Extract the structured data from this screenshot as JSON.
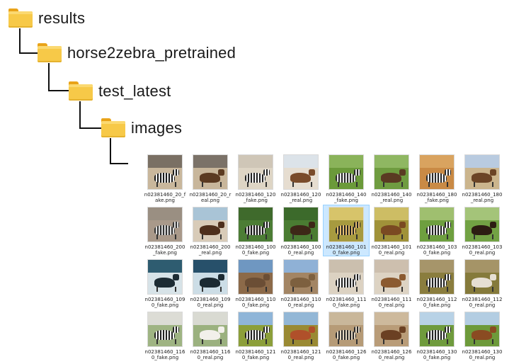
{
  "tree": {
    "results": "results",
    "horse2zebra": "horse2zebra_pretrained",
    "test_latest": "test_latest",
    "images": "images"
  },
  "files": [
    {
      "name": "n02381460_20_fake.png",
      "style": "bg-zebra-sand",
      "selected": false
    },
    {
      "name": "n02381460_20_real.png",
      "style": "bg-horse-sand",
      "selected": false
    },
    {
      "name": "n02381460_120_fake.png",
      "style": "bg-zebra-light",
      "selected": false
    },
    {
      "name": "n02381460_120_real.png",
      "style": "bg-horse-light",
      "selected": false
    },
    {
      "name": "n02381460_140_fake.png",
      "style": "bg-zebra-grass",
      "selected": false
    },
    {
      "name": "n02381460_140_real.png",
      "style": "bg-horse-grass",
      "selected": false
    },
    {
      "name": "n02381460_180_fake.png",
      "style": "bg-zebra-desert",
      "selected": false
    },
    {
      "name": "n02381460_180_real.png",
      "style": "bg-horse-desert",
      "selected": false
    },
    {
      "name": "n02381460_200_fake.png",
      "style": "bg-zebra-beach",
      "selected": false
    },
    {
      "name": "n02381460_200_real.png",
      "style": "bg-horse-beach",
      "selected": false
    },
    {
      "name": "n02381460_1000_fake.png",
      "style": "bg-zebra-forest",
      "selected": false
    },
    {
      "name": "n02381460_1000_real.png",
      "style": "bg-horse-forest",
      "selected": false
    },
    {
      "name": "n02381460_1010_fake.png",
      "style": "bg-zebra-yellow",
      "selected": true
    },
    {
      "name": "n02381460_1010_real.png",
      "style": "bg-horse-yellow",
      "selected": false
    },
    {
      "name": "n02381460_1030_fake.png",
      "style": "bg-zebra-field",
      "selected": false
    },
    {
      "name": "n02381460_1030_real.png",
      "style": "bg-horse-field",
      "selected": false
    },
    {
      "name": "n02381460_1090_fake.png",
      "style": "bg-mirror-z",
      "selected": false
    },
    {
      "name": "n02381460_1090_real.png",
      "style": "bg-mirror-h",
      "selected": false
    },
    {
      "name": "n02381460_1100_fake.png",
      "style": "bg-land-z",
      "selected": false
    },
    {
      "name": "n02381460_1100_real.png",
      "style": "bg-land-h",
      "selected": false
    },
    {
      "name": "n02381460_1110_fake.png",
      "style": "bg-zebra-rest",
      "selected": false
    },
    {
      "name": "n02381460_1110_real.png",
      "style": "bg-horse-rest",
      "selected": false
    },
    {
      "name": "n02381460_1120_fake.png",
      "style": "bg-zebra-run",
      "selected": false
    },
    {
      "name": "n02381460_1120_real.png",
      "style": "bg-horse-run",
      "selected": false
    },
    {
      "name": "n02381460_1160_fake.png",
      "style": "bg-zebra-white",
      "selected": false
    },
    {
      "name": "n02381460_1160_real.png",
      "style": "bg-horse-white",
      "selected": false
    },
    {
      "name": "n02381460_1210_fake.png",
      "style": "bg-zebra-flowers",
      "selected": false
    },
    {
      "name": "n02381460_1210_real.png",
      "style": "bg-horse-flowers",
      "selected": false
    },
    {
      "name": "n02381460_1260_fake.png",
      "style": "bg-zebra-face",
      "selected": false
    },
    {
      "name": "n02381460_1260_real.png",
      "style": "bg-horse-face",
      "selected": false
    },
    {
      "name": "n02381460_1300_fake.png",
      "style": "bg-zebra-meadow",
      "selected": false
    },
    {
      "name": "n02381460_1300_real.png",
      "style": "bg-horse-meadow",
      "selected": false
    }
  ]
}
